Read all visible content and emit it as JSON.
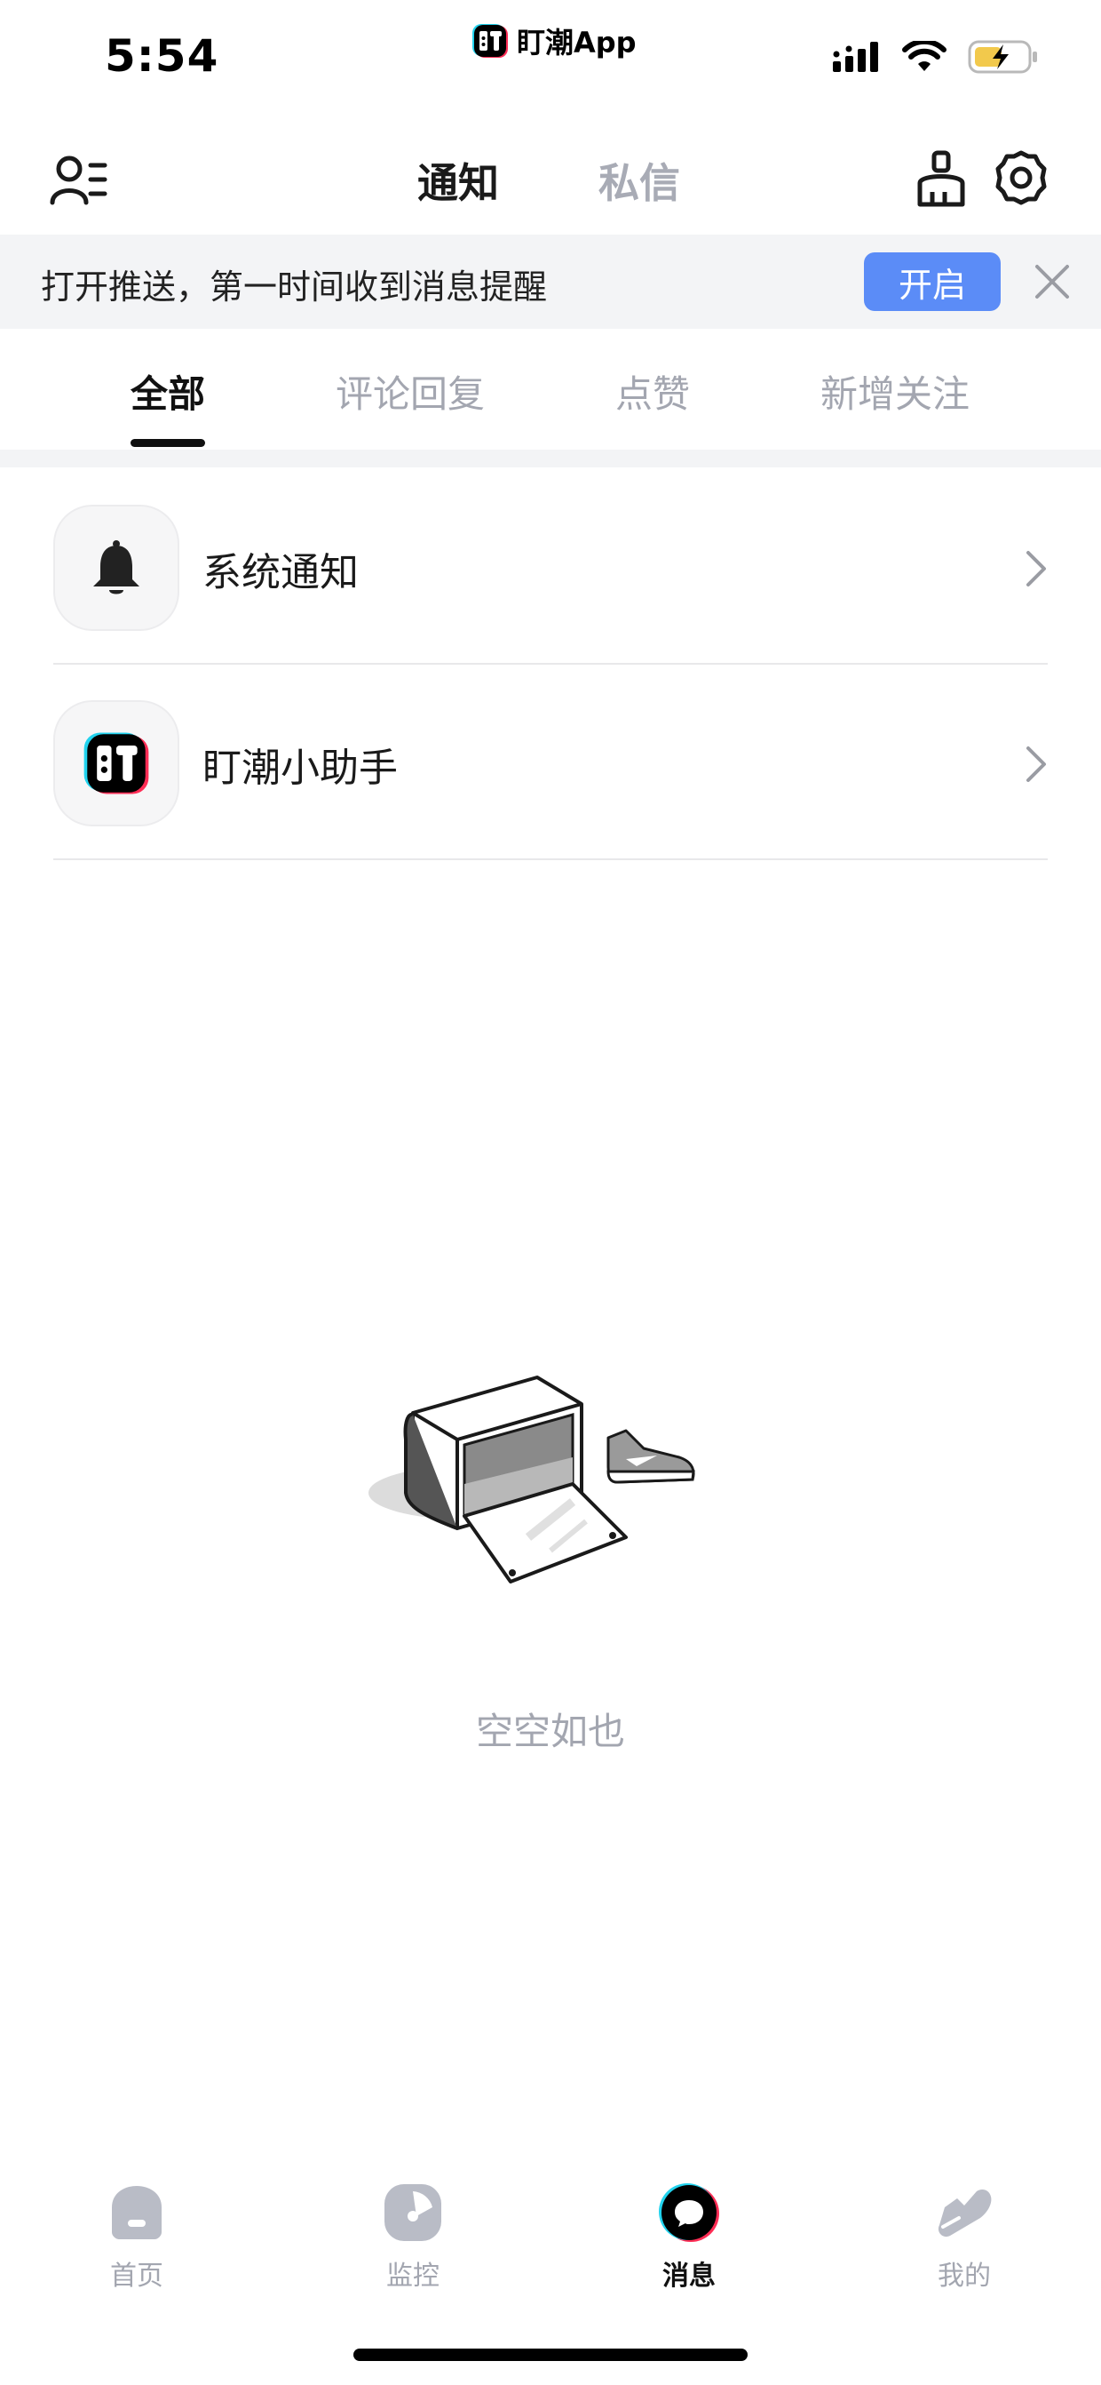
{
  "status_bar": {
    "time": "5:54",
    "app_name": "盯潮App",
    "battery_color": "#f2c94c"
  },
  "header": {
    "tabs": [
      {
        "label": "通知",
        "active": true
      },
      {
        "label": "私信",
        "active": false
      }
    ],
    "icons": [
      "user-list-icon",
      "brush-icon",
      "gear-icon"
    ]
  },
  "push_banner": {
    "text": "打开推送，第一时间收到消息提醒",
    "button_label": "开启",
    "accent": "#5b8cf7"
  },
  "sub_tabs": [
    {
      "label": "全部",
      "active": true
    },
    {
      "label": "评论回复",
      "active": false
    },
    {
      "label": "点赞",
      "active": false
    },
    {
      "label": "新增关注",
      "active": false
    }
  ],
  "list": [
    {
      "label": "系统通知",
      "icon": "bell-icon"
    },
    {
      "label": "盯潮小助手",
      "icon": "app-logo-icon"
    }
  ],
  "empty_state": {
    "text": "空空如也",
    "icon": "empty-shoebox-illustration"
  },
  "bottom_nav": [
    {
      "label": "首页",
      "icon": "home-icon",
      "active": false
    },
    {
      "label": "监控",
      "icon": "monitor-icon",
      "active": false
    },
    {
      "label": "消息",
      "icon": "message-icon",
      "active": true
    },
    {
      "label": "我的",
      "icon": "sneaker-icon",
      "active": false
    }
  ]
}
